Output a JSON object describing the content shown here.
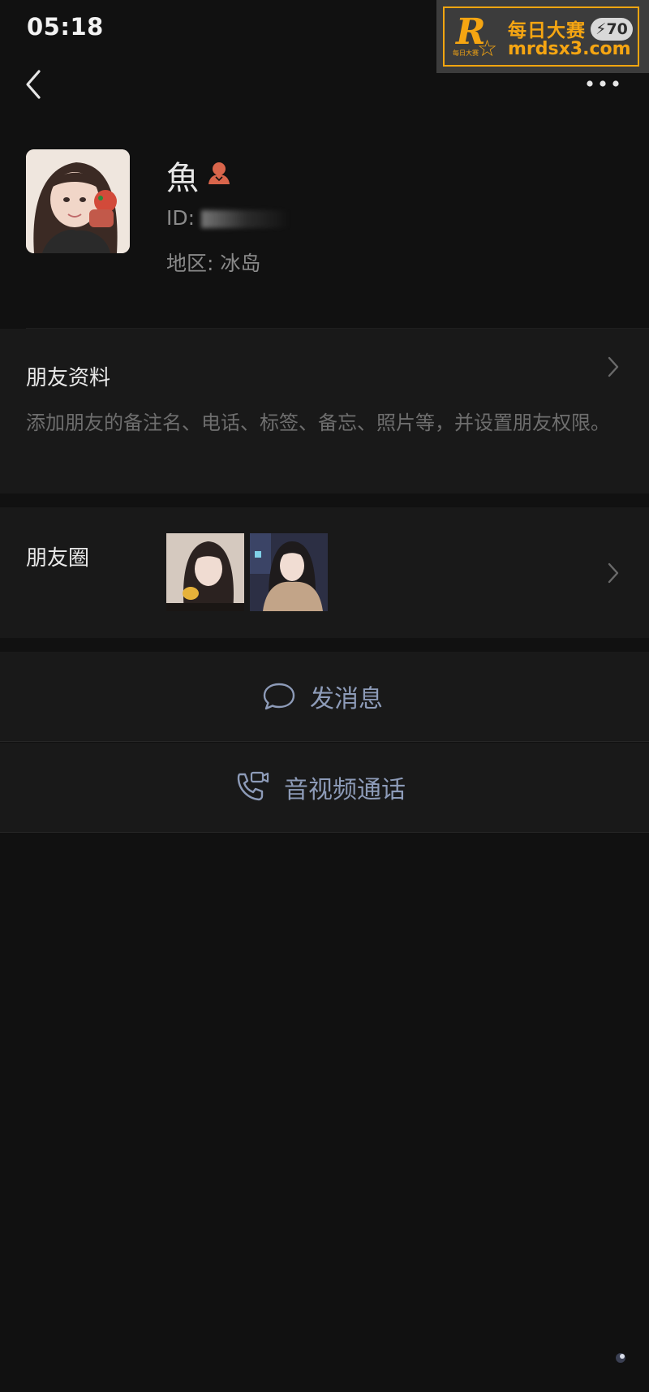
{
  "status_bar": {
    "time": "05:18",
    "battery": "70"
  },
  "watermark": {
    "logo": "R",
    "small_text": "每日大赛",
    "title": "每日大赛",
    "url": "mrdsx3.com"
  },
  "nav": {
    "back_icon": "chevron-left-icon",
    "more_icon": "more-dots-icon"
  },
  "profile": {
    "name": "魚",
    "gender_icon": "female-icon",
    "id_label": "ID:",
    "region": "地区: 冰岛"
  },
  "friend_info": {
    "title": "朋友资料",
    "description": "添加朋友的备注名、电话、标签、备忘、照片等，并设置朋友权限。"
  },
  "moments": {
    "title": "朋友圈",
    "thumbnail_count": 2
  },
  "actions": {
    "send_message": "发消息",
    "call": "音视频通话"
  },
  "colors": {
    "background": "#111111",
    "row_background": "#191919",
    "link_text": "#8d9bb8",
    "gender_icon": "#d9654b",
    "watermark_accent": "#f5a512"
  }
}
